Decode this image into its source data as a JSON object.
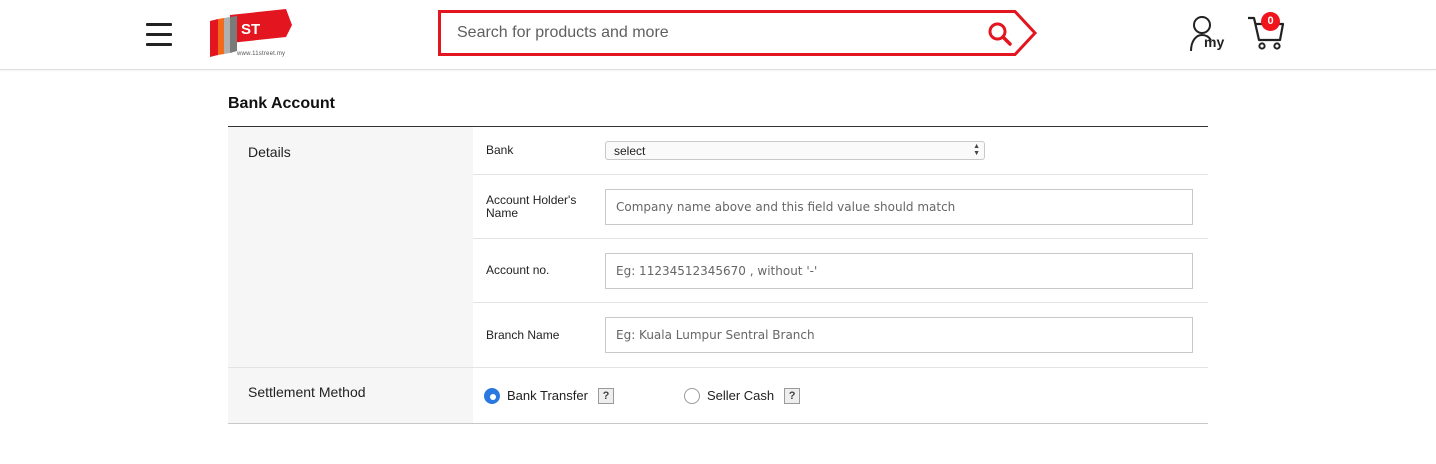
{
  "header": {
    "logo_text": "11ST",
    "logo_url": "www.11street.my",
    "search_placeholder": "Search for products and more",
    "account_label": "my",
    "cart_count": "0",
    "brand_color": "#e3151f"
  },
  "main": {
    "title": "Bank Account",
    "details": {
      "heading": "Details",
      "bank": {
        "label": "Bank",
        "selected": "select"
      },
      "holder": {
        "label": "Account Holder's Name",
        "placeholder": "Company name above and this field value should match"
      },
      "account_no": {
        "label": "Account no.",
        "placeholder": "Eg: 11234512345670 , without '-'"
      },
      "branch": {
        "label": "Branch Name",
        "placeholder": "Eg: Kuala Lumpur Sentral Branch"
      }
    },
    "settlement": {
      "heading": "Settlement Method",
      "options": [
        {
          "label": "Bank Transfer",
          "checked": true,
          "help": "?"
        },
        {
          "label": "Seller Cash",
          "checked": false,
          "help": "?"
        }
      ]
    }
  }
}
